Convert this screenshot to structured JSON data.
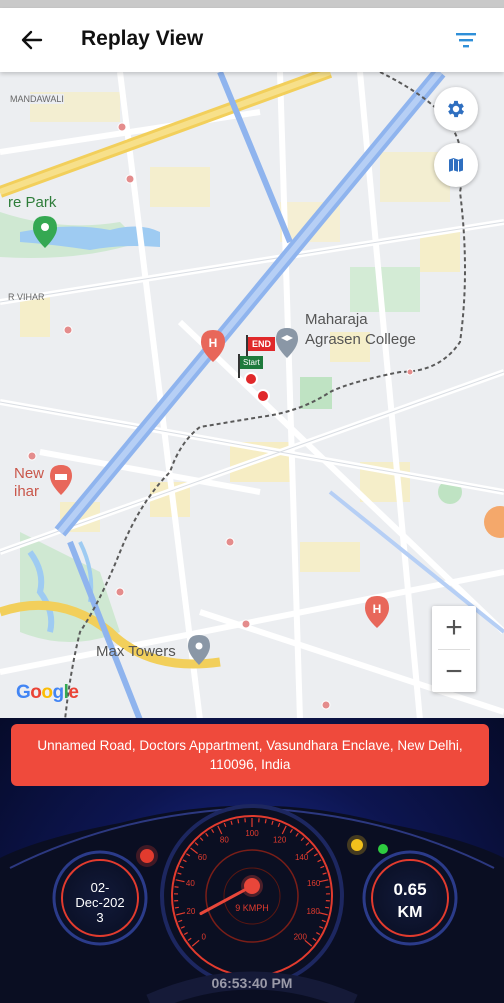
{
  "app": {
    "title": "Replay View"
  },
  "map": {
    "labels": {
      "mandawali": "MANDAWALI",
      "park": "re Park",
      "vihar": "R VIHAR",
      "college_line1": "Maharaja",
      "college_line2": "Agrasen College",
      "new": "New",
      "ihar": "ihar",
      "max_towers": "Max Towers",
      "flag_end": "END",
      "flag_start": "Start"
    },
    "attribution": [
      "G",
      "o",
      "o",
      "g",
      "l",
      "e"
    ],
    "zoom_in": "+",
    "zoom_out": "−"
  },
  "dashboard": {
    "address": "Unnamed Road, Doctors Appartment, Vasundhara Enclave, New Delhi, 110096, India",
    "date": "02-Dec-2023",
    "date_display": "02-\nDec-202\n3",
    "distance_value": "0.65",
    "distance_unit": "KM",
    "speed_label": "9 KMPH",
    "speed_kmph": 9,
    "speedometer_ticks": [
      "0",
      "20",
      "40",
      "60",
      "80",
      "100",
      "120",
      "140",
      "160",
      "180",
      "200"
    ],
    "time": "06:53:40 PM"
  },
  "colors": {
    "accent_blue": "#2f80c8",
    "address_red": "#ef4a3c",
    "gauge_red": "#e23b2e",
    "poi_red": "#e8675a",
    "park_green": "#35a852"
  }
}
